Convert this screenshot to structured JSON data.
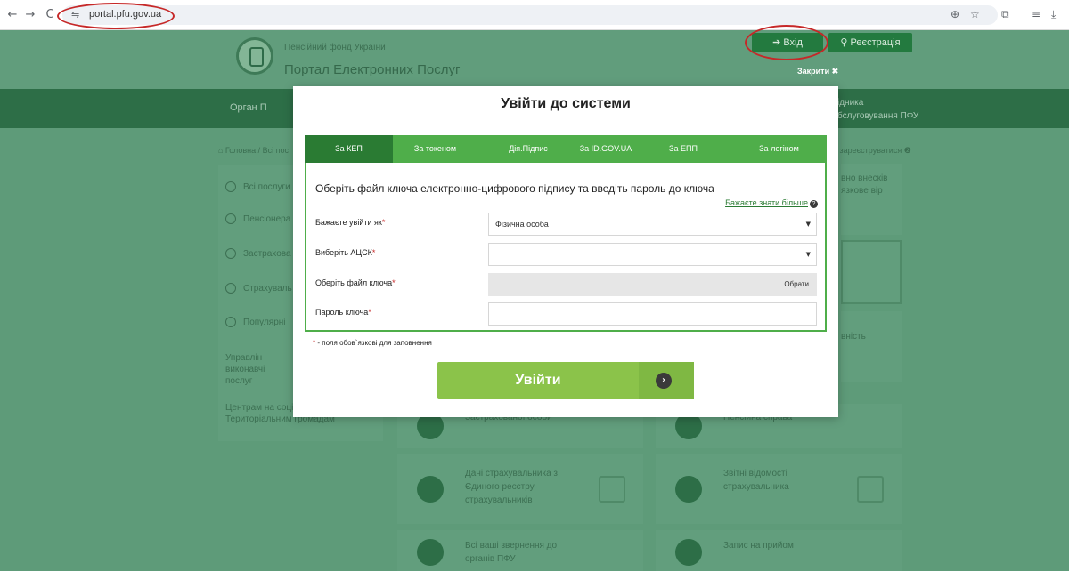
{
  "browser": {
    "url": "portal.pfu.gov.ua",
    "back_icon": "←",
    "forward_icon": "→",
    "reload_icon": "C",
    "site_icon": "⇋",
    "right_icons": [
      "⊕",
      "☆",
      "⧉",
      "≡",
      "⤓"
    ]
  },
  "header": {
    "org_name": "Пенсійний фонд України",
    "portal_title": "Портал Електронних Послуг",
    "login_label": "➔ Вхід",
    "register_label": "⚲ Реєстрація",
    "close_label": "Закрити ✖"
  },
  "nav": {
    "left_item": "Орган П",
    "right_item_line1": "ідника",
    "right_item_line2": "бслуговування ПФУ"
  },
  "breadcrumb": "⌂ Головна / Всі пос",
  "hint_right": "к зареєструватися ❷",
  "sidebar": {
    "items": [
      {
        "label": "Всі послуги"
      },
      {
        "label": "Пенсіонера"
      },
      {
        "label": "Застрахова"
      },
      {
        "label": "Страхуваль"
      },
      {
        "label": "Популярні"
      },
      {
        "label": "Управлін виконавчі послуг"
      },
      {
        "label": "Центрам на соціальної сфери / Територіальним громадам"
      }
    ]
  },
  "cards": [
    {
      "text": "Застрахованої особи"
    },
    {
      "text": "Дані страхувальника з Єдиного реєстру страхувальників"
    },
    {
      "text": "Всі ваші звернення до органів ПФУ"
    }
  ],
  "right_cards": [
    {
      "text": "Звітні відомості страхувальника"
    },
    {
      "text": "Запис на прийом"
    },
    {
      "text": "Пенсійна справа"
    }
  ],
  "right_texts": [
    {
      "text": "вно внесків язкове вір"
    },
    {
      "text": "вність"
    }
  ],
  "modal": {
    "title": "Увійти до системи",
    "tabs": [
      {
        "label": "За КЕП",
        "active": true
      },
      {
        "label": "За токеном",
        "active": false
      },
      {
        "label": "Дія.Підпис",
        "active": false
      },
      {
        "label": "За ID.GOV.UA",
        "active": false
      },
      {
        "label": "За ЕПП",
        "active": false
      },
      {
        "label": "За логіном",
        "active": false
      }
    ],
    "heading": "Оберіть файл ключа електронно-цифрового підпису та введіть пароль до ключа",
    "more_link": "Бажаєте знати більше",
    "more_icon": "?",
    "fields": {
      "login_as": {
        "label": "Бажаєте увійти як",
        "value": "Фізична особа"
      },
      "acsk": {
        "label": "Виберіть АЦСК",
        "value": ""
      },
      "key_file": {
        "label": "Оберіть файл ключа",
        "button": "Обрати"
      },
      "key_password": {
        "label": "Пароль ключа",
        "value": ""
      }
    },
    "required_star": "*",
    "required_note": " - поля обов`язкові для заповнення",
    "submit_label": "Увійти",
    "submit_arrow": "›"
  }
}
